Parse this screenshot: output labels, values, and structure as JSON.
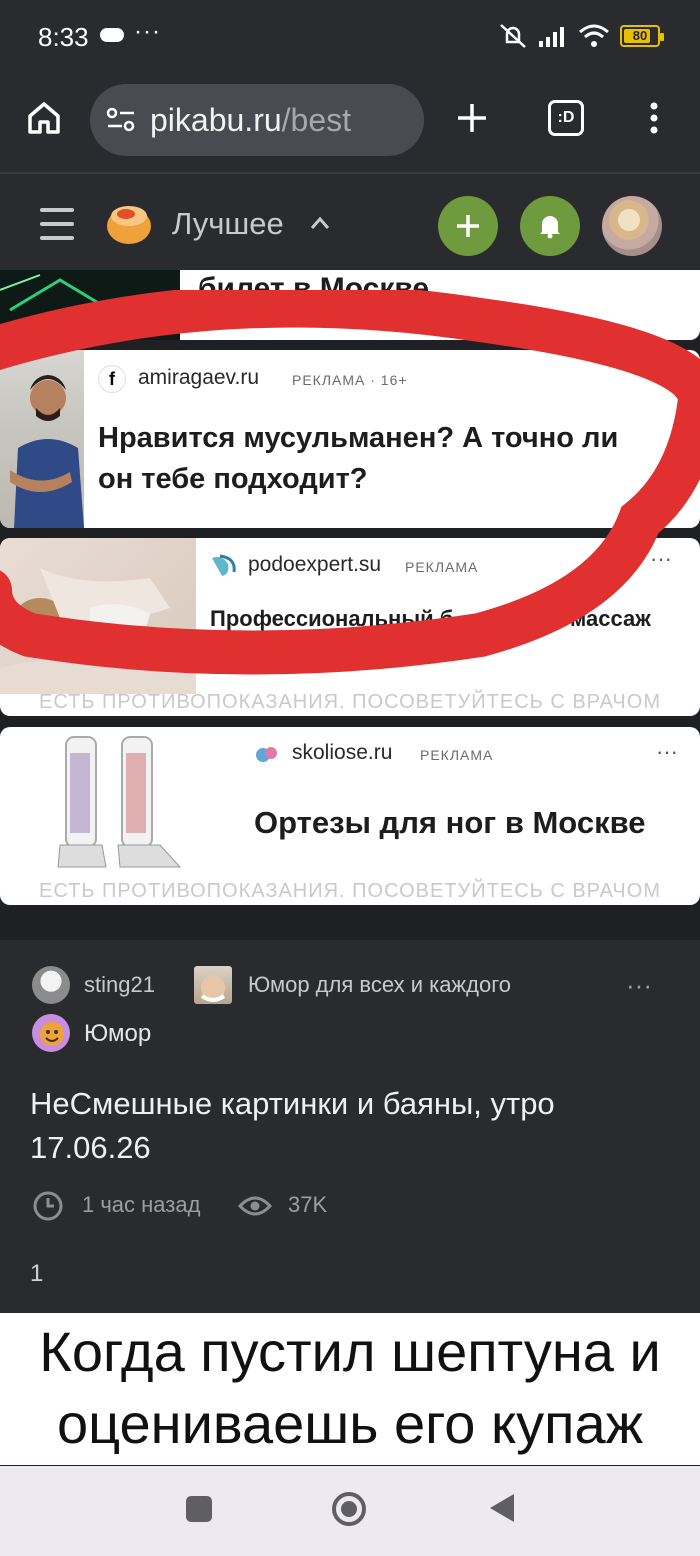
{
  "status": {
    "time": "8:33",
    "dots": "···",
    "battery": "80"
  },
  "browser": {
    "host": "pikabu.ru",
    "path": "/best",
    "tabs_label": ":D"
  },
  "site": {
    "section_title": "Лучшее"
  },
  "prev_card": {
    "title": "билет в Москве"
  },
  "ads": [
    {
      "domain": "amiragaev.ru",
      "tag": "РЕКЛАМА · 16+",
      "title_line1": "Нравится мусульманен? А точно ли",
      "title_line2": "он тебе подходит?"
    },
    {
      "domain": "podoexpert.su",
      "tag": "РЕКЛАМА",
      "title_line1": "Профессиональный б",
      "title_line1b": "массаж",
      "title_line2": "...",
      "warning": "ЕСТЬ ПРОТИВОПОКАЗАНИЯ. ПОСОВЕТУЙТЕСЬ С ВРАЧОМ",
      "more": "···"
    },
    {
      "domain": "skoliose.ru",
      "tag": "РЕКЛАМА",
      "title": "Ортезы для ног в Москве",
      "warning": "ЕСТЬ ПРОТИВОПОКАЗАНИЯ. ПОСОВЕТУЙТЕСЬ С ВРАЧОМ",
      "more": "···"
    }
  ],
  "post": {
    "author": "sting21",
    "community": "Юмор для всех и каждого",
    "tag": "Юмор",
    "title_line1": "НеСмешные картинки и баяны, утро",
    "title_line2": "17.06.26",
    "time_ago": "1 час назад",
    "views": "37K",
    "counter": "1",
    "more": "···"
  },
  "meme": {
    "line1": "Когда пустил шептуна и",
    "line2": "оцениваешь его купаж"
  },
  "colors": {
    "accent_green": "#6f9a3e",
    "annotation_red": "#e03030"
  }
}
